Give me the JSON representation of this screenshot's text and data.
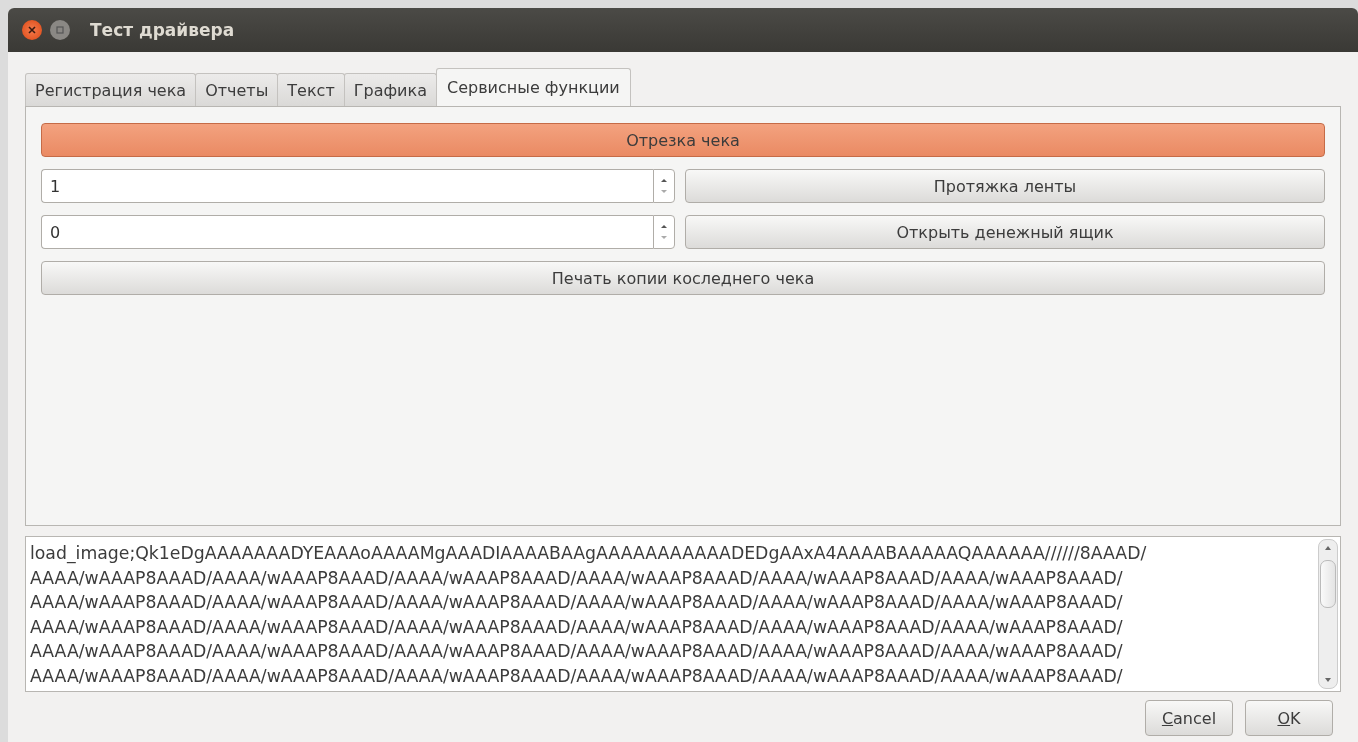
{
  "window": {
    "title": "Тест драйвера"
  },
  "tabs": [
    {
      "label": "Регистрация чека",
      "selected": false
    },
    {
      "label": "Отчеты",
      "selected": false
    },
    {
      "label": "Текст",
      "selected": false
    },
    {
      "label": "Графика",
      "selected": false
    },
    {
      "label": "Сервисные функции",
      "selected": true
    }
  ],
  "cut_button": {
    "label": "Отрезка чека"
  },
  "rows": [
    {
      "spin_value": "1",
      "button": "Протяжка  ленты"
    },
    {
      "spin_value": "0",
      "button": "Открыть денежный ящик"
    }
  ],
  "print_copy_button": {
    "label": "Печать копии коследнего чека"
  },
  "log_lines": [
    "load_image;Qk1eDgAAAAAAADYEAAAoAAAAMgAAADIAAAABAAgAAAAAAAAAAADEDgAAxA4AAAABAAAAAQAAAAAA//////8AAAD/",
    "AAAA/wAAAP8AAAD/AAAA/wAAAP8AAAD/AAAA/wAAAP8AAAD/AAAA/wAAAP8AAAD/AAAA/wAAAP8AAAD/AAAA/wAAAP8AAAD/",
    "AAAA/wAAAP8AAAD/AAAA/wAAAP8AAAD/AAAA/wAAAP8AAAD/AAAA/wAAAP8AAAD/AAAA/wAAAP8AAAD/AAAA/wAAAP8AAAD/",
    "AAAA/wAAAP8AAAD/AAAA/wAAAP8AAAD/AAAA/wAAAP8AAAD/AAAA/wAAAP8AAAD/AAAA/wAAAP8AAAD/AAAA/wAAAP8AAAD/",
    "AAAA/wAAAP8AAAD/AAAA/wAAAP8AAAD/AAAA/wAAAP8AAAD/AAAA/wAAAP8AAAD/AAAA/wAAAP8AAAD/AAAA/wAAAP8AAAD/",
    "AAAA/wAAAP8AAAD/AAAA/wAAAP8AAAD/AAAA/wAAAP8AAAD/AAAA/wAAAP8AAAD/AAAA/wAAAP8AAAD/AAAA/wAAAP8AAAD/"
  ],
  "dialog_buttons": [
    {
      "label": "Cancel"
    },
    {
      "label": "OK"
    }
  ]
}
